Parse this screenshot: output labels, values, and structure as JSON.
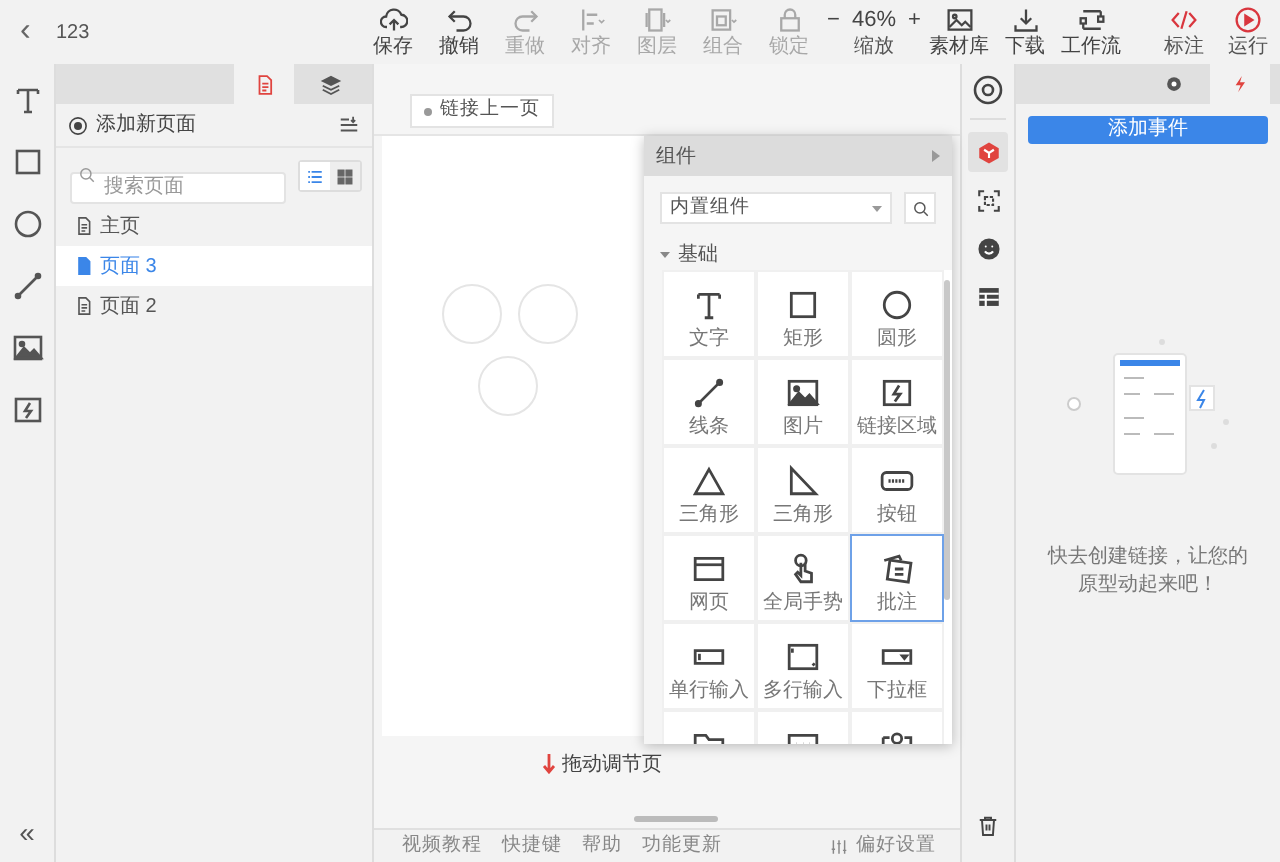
{
  "toolbar": {
    "back": "‹",
    "project": "123",
    "tools": [
      {
        "label": "保存",
        "disabled": false
      },
      {
        "label": "撤销",
        "disabled": false
      },
      {
        "label": "重做",
        "disabled": true
      },
      {
        "label": "对齐",
        "disabled": true
      },
      {
        "label": "图层",
        "disabled": true
      },
      {
        "label": "组合",
        "disabled": true
      },
      {
        "label": "锁定",
        "disabled": true
      }
    ],
    "zoom": {
      "minus": "−",
      "value": "46%",
      "plus": "+",
      "label": "缩放"
    },
    "tools_right": [
      {
        "label": "素材库",
        "disabled": false
      },
      {
        "label": "下载",
        "disabled": false
      },
      {
        "label": "工作流",
        "disabled": false
      }
    ],
    "actions": [
      {
        "label": "标注"
      },
      {
        "label": "运行"
      }
    ]
  },
  "left_tools": {
    "collapse": "«"
  },
  "pages_panel": {
    "tabs": [
      {
        "selected": true
      },
      {
        "selected": false
      }
    ],
    "add_page": "添加新页面",
    "search": {
      "placeholder": "搜索页面"
    },
    "views": [
      {
        "selected": true
      },
      {
        "selected": false
      }
    ],
    "pages": [
      {
        "label": "主页",
        "selected": false
      },
      {
        "label": "页面 3",
        "selected": true
      },
      {
        "label": "页面 2",
        "selected": false
      }
    ]
  },
  "canvas": {
    "link_prev": "链接上一页",
    "drag_hint": "拖动调节页"
  },
  "components": {
    "title": "组件",
    "source": "内置组件",
    "category": {
      "label": "基础",
      "expanded": true
    },
    "items": [
      {
        "label": "文字",
        "selected": false
      },
      {
        "label": "矩形",
        "selected": false
      },
      {
        "label": "圆形",
        "selected": false
      },
      {
        "label": "线条",
        "selected": false
      },
      {
        "label": "图片",
        "selected": false
      },
      {
        "label": "链接区域",
        "selected": false
      },
      {
        "label": "三角形",
        "selected": false
      },
      {
        "label": "三角形",
        "selected": false
      },
      {
        "label": "按钮",
        "selected": false
      },
      {
        "label": "网页",
        "selected": false
      },
      {
        "label": "全局手势",
        "selected": false
      },
      {
        "label": "批注",
        "selected": true
      },
      {
        "label": "单行输入",
        "selected": false
      },
      {
        "label": "多行输入",
        "selected": false
      },
      {
        "label": "下拉框",
        "selected": false
      },
      {
        "selected": false
      },
      {
        "selected": false
      },
      {
        "selected": false
      }
    ]
  },
  "side_icons": [
    {
      "selected": true
    },
    {
      "selected": false
    },
    {
      "selected": false
    },
    {
      "selected": false
    }
  ],
  "right_panel": {
    "tabs": [
      {
        "selected": false
      },
      {
        "selected": true
      }
    ],
    "add_event": "添加事件",
    "empty_message": "快去创建链接，让您的原型动起来吧！"
  },
  "footer": {
    "links": [
      "视频教程",
      "快捷键",
      "帮助",
      "功能更新"
    ],
    "preferences": "偏好设置"
  }
}
